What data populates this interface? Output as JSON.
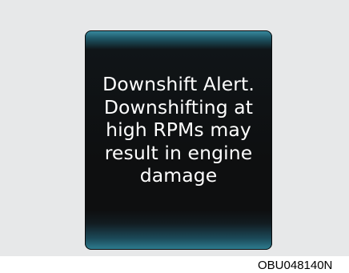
{
  "display": {
    "alert_lines": [
      "Downshift Alert.",
      "Downshifting at",
      "high RPMs may",
      "result in engine",
      "damage"
    ]
  },
  "caption": {
    "figure_code": "OBU048140N"
  }
}
